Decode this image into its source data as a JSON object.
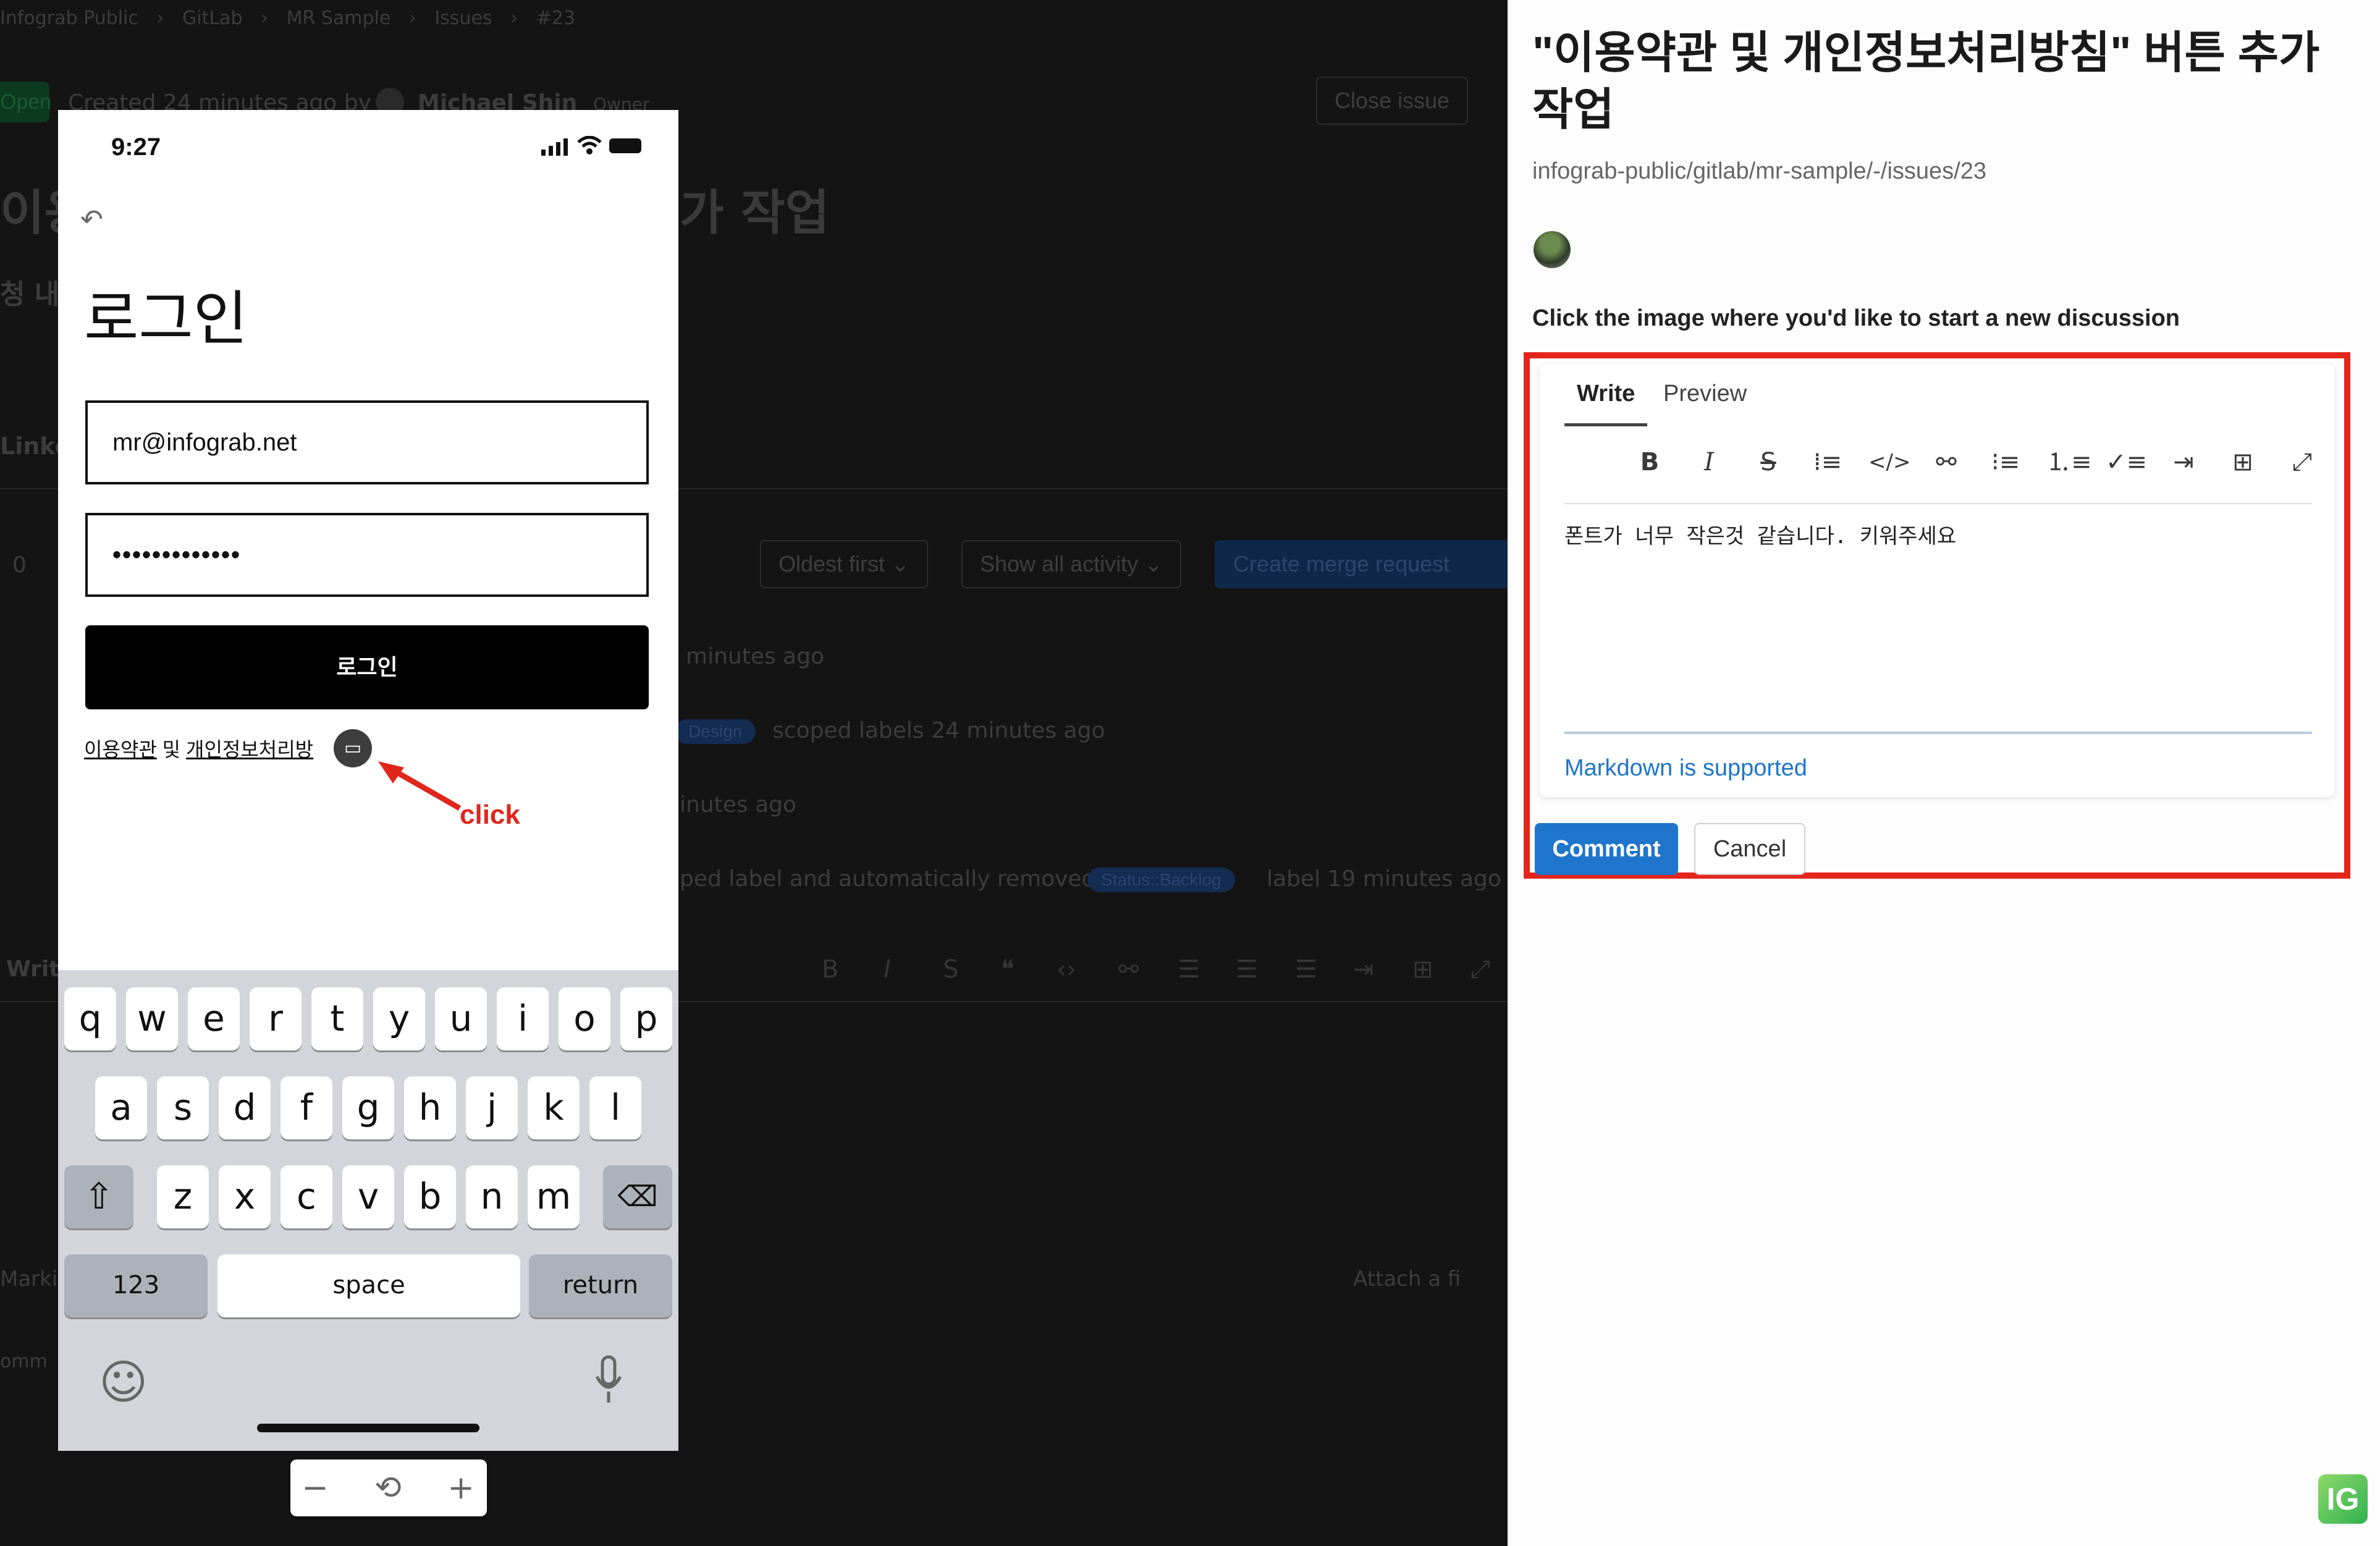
{
  "background_app": {
    "breadcrumb": [
      "Infograb Public",
      "GitLab",
      "MR Sample",
      "Issues",
      "#23"
    ],
    "status_badge": "Open",
    "created_text": "Created 24 minutes ago by",
    "author": "Michael Shin",
    "author_role": "Owner",
    "close_issue_button": "Close issue",
    "title_fragment_left": "이용",
    "title_fragment_right": "가 작업",
    "sort_dropdown": "Oldest first",
    "activity_dropdown": "Show all activity",
    "create_mr_button": "Create merge request",
    "activity": [
      "minutes ago",
      "scoped labels 24 minutes ago",
      "inutes ago",
      "ped label and automatically removed",
      "label 19 minutes ago"
    ],
    "labels": [
      "Design",
      "Status::Backlog"
    ],
    "attach_file": "Attach a fi",
    "thumbs_count": "0"
  },
  "phone": {
    "time": "9:27",
    "back_icon": "back-arrow-icon",
    "heading": "로그인",
    "email_value": "mr@infograb.net",
    "password_value": "•••••••••••••",
    "login_button": "로그인",
    "terms_link": "이용약관",
    "terms_conjunction": "및",
    "privacy_link": "개인정보처리방",
    "annotation_label": "click",
    "annotation_color": "#e0261b",
    "keyboard": {
      "row1": [
        "q",
        "w",
        "e",
        "r",
        "t",
        "y",
        "u",
        "i",
        "o",
        "p"
      ],
      "row2": [
        "a",
        "s",
        "d",
        "f",
        "g",
        "h",
        "j",
        "k",
        "l"
      ],
      "row3": [
        "z",
        "x",
        "c",
        "v",
        "b",
        "n",
        "m"
      ],
      "numbers_key": "123",
      "space_key": "space",
      "return_key": "return"
    }
  },
  "zoom_controls": {
    "minus": "−",
    "reset": "⟲",
    "plus": "+"
  },
  "panel": {
    "title": "\"이용약관 및 개인정보처리방침\" 버튼 추가 작업",
    "path": "infograb-public/gitlab/mr-sample/-/issues/23",
    "instruction": "Click the image where you'd like to start a new discussion",
    "tabs": {
      "write": "Write",
      "preview": "Preview"
    },
    "toolbar_icons": [
      "bold",
      "italic",
      "strikethrough",
      "quote",
      "code",
      "link",
      "bullet-list",
      "numbered-list",
      "task-list",
      "indent",
      "table",
      "fullscreen"
    ],
    "comment_text": "폰트가 너무 작은것 같습니다. 키워주세요",
    "markdown_link": "Markdown is supported",
    "comment_button": "Comment",
    "cancel_button": "Cancel",
    "highlight_color": "#e3261c",
    "accent_color": "#1f75cb"
  },
  "watermark": "IG"
}
